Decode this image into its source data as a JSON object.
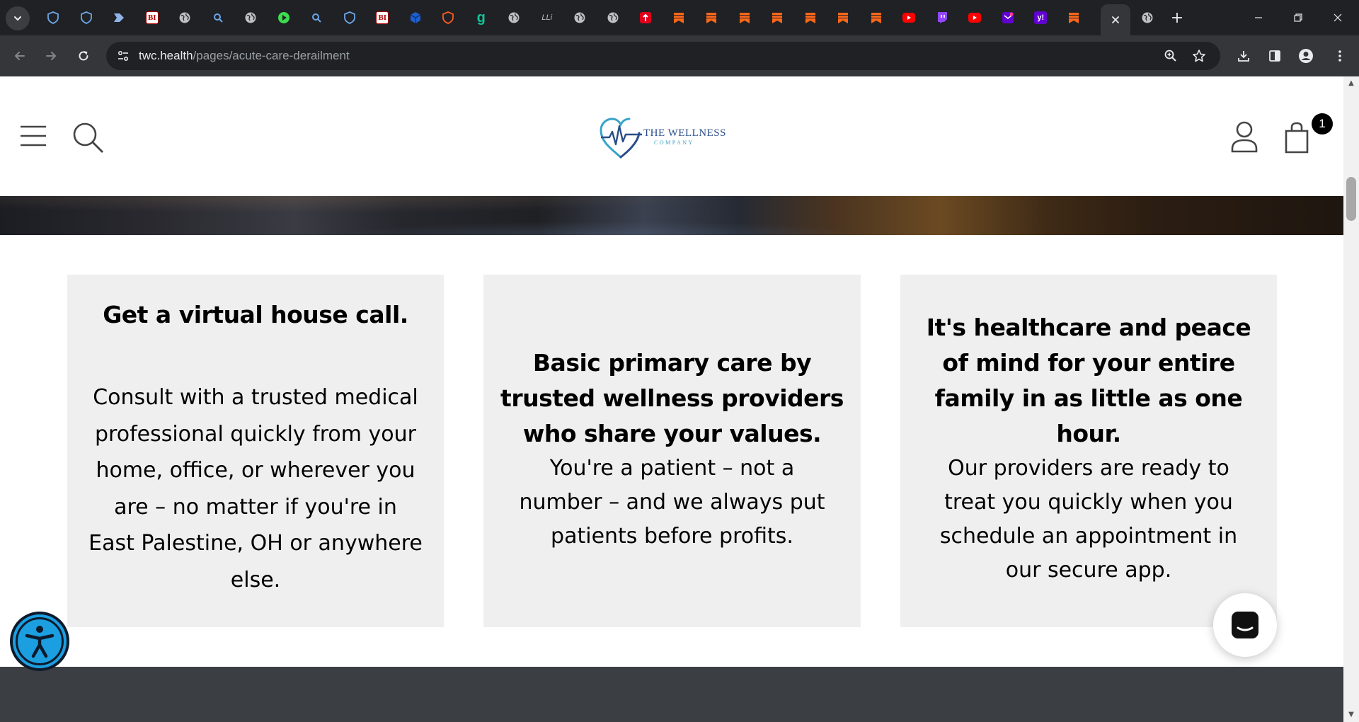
{
  "browser": {
    "tabs": [
      {
        "icon": "shield-favicon",
        "color": "#6ba7e8"
      },
      {
        "icon": "shield-favicon",
        "color": "#6ba7e8"
      },
      {
        "icon": "chevron-favicon",
        "color": "#8fb4e8"
      },
      {
        "icon": "bi-favicon",
        "color": "#b30000",
        "text": "BI"
      },
      {
        "icon": "globe-favicon",
        "color": "#bdc1c6"
      },
      {
        "icon": "search-favicon",
        "color": "#6ba7e8"
      },
      {
        "icon": "globe-favicon",
        "color": "#bdc1c6"
      },
      {
        "icon": "play-favicon",
        "color": "#3ddc4f"
      },
      {
        "icon": "search-favicon",
        "color": "#6ba7e8"
      },
      {
        "icon": "shield-favicon",
        "color": "#6ba7e8"
      },
      {
        "icon": "bi-favicon",
        "color": "#b30000",
        "text": "BI"
      },
      {
        "icon": "cube-favicon",
        "color": "#1d5fd1"
      },
      {
        "icon": "shield-favicon",
        "color": "#ff5a1f"
      },
      {
        "icon": "g-favicon",
        "color": "#15c39a",
        "text": "g"
      },
      {
        "icon": "globe-favicon",
        "color": "#bdc1c6"
      },
      {
        "icon": "slash-favicon",
        "color": "#bdc1c6",
        "text": "LLi"
      },
      {
        "icon": "globe-favicon",
        "color": "#bdc1c6"
      },
      {
        "icon": "globe-favicon",
        "color": "#bdc1c6"
      },
      {
        "icon": "red-favicon",
        "color": "#e0001b"
      },
      {
        "icon": "bookmark-favicon",
        "color": "#ff6719"
      },
      {
        "icon": "bookmark-favicon",
        "color": "#ff6719"
      },
      {
        "icon": "bookmark-favicon",
        "color": "#ff6719"
      },
      {
        "icon": "bookmark-favicon",
        "color": "#ff6719"
      },
      {
        "icon": "bookmark-favicon",
        "color": "#ff6719"
      },
      {
        "icon": "bookmark-favicon",
        "color": "#ff6719"
      },
      {
        "icon": "bookmark-favicon",
        "color": "#ff6719"
      },
      {
        "icon": "youtube-favicon",
        "color": "#ff0000"
      },
      {
        "icon": "twitch-favicon",
        "color": "#9146ff"
      },
      {
        "icon": "youtube-favicon",
        "color": "#ff0000"
      },
      {
        "icon": "mail-favicon",
        "color": "#6001d2"
      },
      {
        "icon": "yahoo-favicon",
        "color": "#6001d2",
        "text": "y!"
      },
      {
        "icon": "bookmark-favicon",
        "color": "#ff6719"
      }
    ],
    "url": {
      "host": "twc.health",
      "path": "/pages/acute-care-derailment"
    }
  },
  "header": {
    "logo_name": "THE WELLNESS",
    "logo_sub": "COMPANY",
    "cart_count": "1"
  },
  "cards": [
    {
      "heading": "Get a virtual house call.",
      "body_lines": [
        "Consult with a trusted medical",
        "professional quickly from your",
        "home, office, or wherever you",
        "are – no matter if you're in",
        "East Palestine, OH or anywhere",
        "else."
      ]
    },
    {
      "heading_lines": [
        "Basic primary care by",
        "trusted wellness providers",
        "who share your values."
      ],
      "body_lines": [
        "You're a patient – not a",
        "number – and we always put",
        "patients before profits."
      ]
    },
    {
      "heading_lines": [
        "It's healthcare and peace",
        "of mind for your entire",
        "family in as little as one",
        "hour."
      ],
      "body_lines": [
        "Our providers are ready to",
        "treat you quickly when you",
        "schedule an appointment in",
        "our secure app."
      ]
    }
  ],
  "colors": {
    "card_bg": "#efefef",
    "footer_bg": "#3b3e42",
    "accessibility_blue": "#1b9fe0",
    "logo_navy": "#2a4e8a",
    "logo_teal": "#3aa3c8"
  }
}
